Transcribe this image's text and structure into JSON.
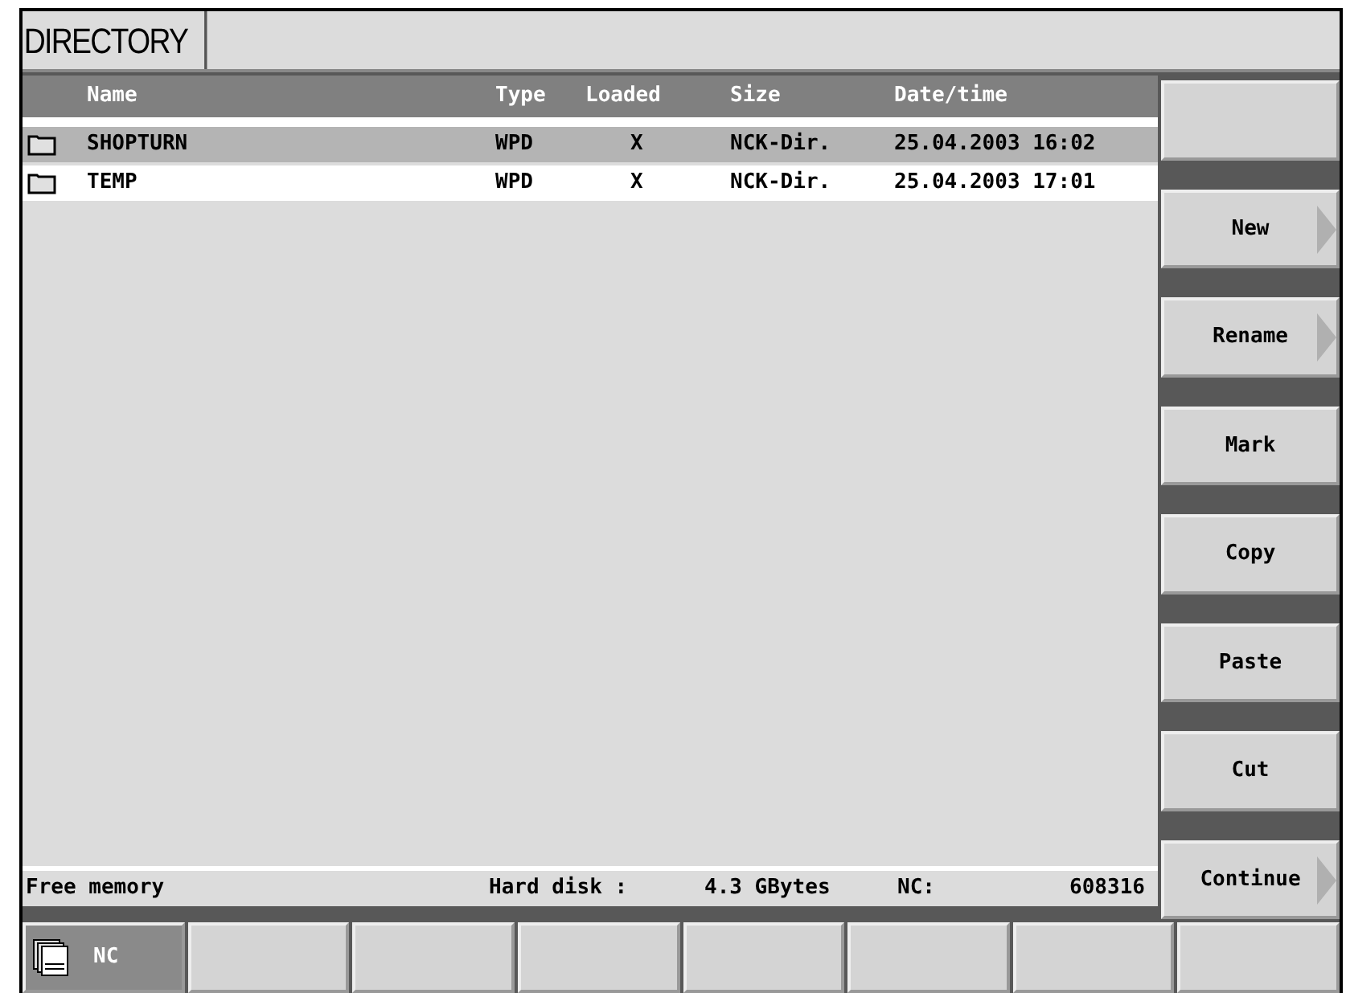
{
  "window": {
    "title": "DIRECTORY"
  },
  "table": {
    "columns": [
      "Name",
      "Type",
      "Loaded",
      "Size",
      "Date/time"
    ],
    "rows": [
      {
        "name": "SHOPTURN",
        "type": "WPD",
        "loaded": "X",
        "size": "NCK-Dir.",
        "date_time": "25.04.2003 16:02",
        "selected": true
      },
      {
        "name": "TEMP",
        "type": "WPD",
        "loaded": "X",
        "size": "NCK-Dir.",
        "date_time": "25.04.2003 17:01",
        "selected": false
      }
    ]
  },
  "status_bar": {
    "free_memory": "Free memory",
    "hard_disk_label": "Hard disk :",
    "hard_disk_value": "4.3 GBytes",
    "nc_label": "NC:",
    "nc_value": "608316"
  },
  "vertical_softkeys": [
    {
      "submenu": false
    },
    {
      "label": "New",
      "submenu": true
    },
    {
      "label": "Rename",
      "submenu": true
    },
    {
      "label": "Mark",
      "submenu": false
    },
    {
      "label": "Copy",
      "submenu": false
    },
    {
      "label": "Paste",
      "submenu": false
    },
    {
      "label": "Cut",
      "submenu": false
    },
    {
      "label": "Continue",
      "submenu": true
    }
  ],
  "horizontal_softkeys": [
    {
      "label": "NC",
      "selected": true
    },
    {
      "selected": false
    },
    {
      "selected": false
    },
    {
      "selected": false
    },
    {
      "selected": false
    },
    {
      "selected": false
    },
    {
      "selected": false
    },
    {
      "selected": false
    }
  ]
}
